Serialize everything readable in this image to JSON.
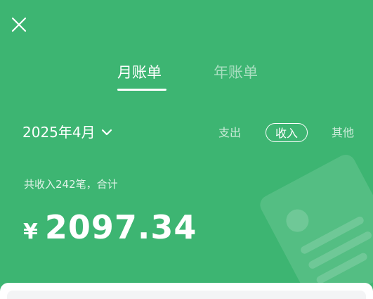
{
  "colors": {
    "background": "#3db572",
    "text": "#ffffff",
    "sheet": "#ffffff",
    "card": "#f3f4f5"
  },
  "icons": {
    "close": "close-icon",
    "chevron": "chevron-down-icon",
    "decoration": "bill-decoration-icon"
  },
  "tabs": {
    "month": "月账单",
    "year": "年账单",
    "active": "month"
  },
  "date_picker": {
    "label": "2025年4月"
  },
  "filters": {
    "expense": "支出",
    "income": "收入",
    "other": "其他",
    "selected": "income"
  },
  "summary": {
    "text": "共收入242笔，合计"
  },
  "amount": {
    "currency": "¥",
    "value": "2097.34"
  }
}
